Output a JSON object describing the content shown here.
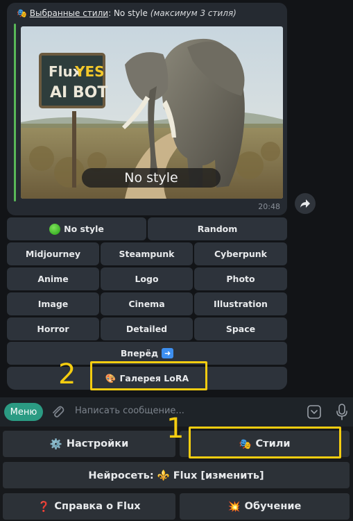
{
  "message": {
    "title_prefix": "Выбранные стили",
    "title_colon": ":",
    "title_value": " No style",
    "title_note": "(максимум 3 стиля)",
    "image": {
      "sign_line1_a": "Flux",
      "sign_line1_b": "YES",
      "sign_line2": "AI BOT",
      "caption": "No style"
    },
    "time": "20:48"
  },
  "style_buttons": {
    "no_style": "No style",
    "random": "Random",
    "midjourney": "Midjourney",
    "steampunk": "Steampunk",
    "cyberpunk": "Cyberpunk",
    "anime": "Anime",
    "logo": "Logo",
    "photo": "Photo",
    "image": "Image",
    "cinema": "Cinema",
    "illustration": "Illustration",
    "horror": "Horror",
    "detailed": "Detailed",
    "space": "Space",
    "forward": "Вперёд",
    "lora_gallery": "Галерея LoRA"
  },
  "annotations": {
    "one": "1",
    "two": "2",
    "highlight_color": "#f5cd10"
  },
  "composer": {
    "menu": "Меню",
    "placeholder": "Написать сообщение..."
  },
  "reply_keyboard": {
    "settings": "Настройки",
    "styles": "Стили",
    "model": "Нейросеть: ⚜️ Flux [изменить]",
    "help": "Справка о Flux",
    "training": "Обучение"
  },
  "colors": {
    "accent": "#2b9b83",
    "quote_bar": "#59b858"
  }
}
